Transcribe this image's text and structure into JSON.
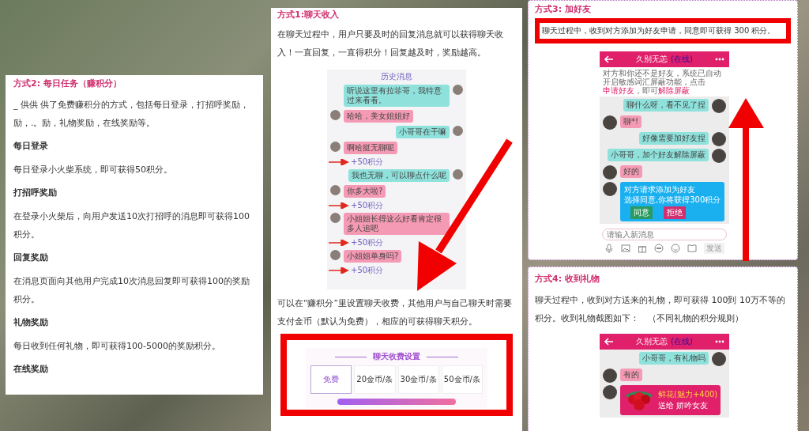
{
  "daily_tasks": {
    "title": "方式2: 每日任务（赚积分）",
    "intro": "_ 供供 供了免费赚积分的方式，包括每日登录，打招呼奖励，励，.。励，礼物奖励，在线奖励等。",
    "sections": [
      {
        "heading": "每日登录",
        "text": "每日登录小火柴系统，即可获得50积分。"
      },
      {
        "heading": "打招呼奖励",
        "text": "在登录小火柴后，向用户发送10次打招呼的消息即可获得100积分。"
      },
      {
        "heading": "回复奖励",
        "text": "在消息页面向其他用户完成10次消息回复即可获得100的奖励积分。"
      },
      {
        "heading": "礼物奖励",
        "text": "每日收到任何礼物，即可获得100-5000的奖励积分。"
      },
      {
        "heading": "在线奖励"
      }
    ]
  },
  "chat_income": {
    "title": "方式1:聊天收入",
    "intro": "在聊天过程中，用户只要及时的回复消息就可以获得聊天收入！一直回复，一直得积分！回复越及时，奖励越高。",
    "chat": {
      "history": "历史消息",
      "messages": [
        {
          "outgoing": true,
          "text": "听说这里有拉菲哥，我特意过来看看。"
        },
        {
          "outgoing": false,
          "text": "哈哈，美女姐姐好"
        },
        {
          "outgoing": true,
          "text": "小哥哥在干嘛"
        },
        {
          "outgoing": false,
          "text": "啊哈挺无聊呢",
          "reward": "+50积分"
        },
        {
          "outgoing": true,
          "text": "我也无聊，可以聊点什么呢"
        },
        {
          "outgoing": false,
          "text": "你多大啦?",
          "reward": "+50积分"
        },
        {
          "outgoing": false,
          "text": "小姐姐长得这么好看肯定很多人追吧",
          "reward": "+50积分"
        },
        {
          "outgoing": false,
          "text": "小姐姐单身吗?",
          "reward": "+50积分"
        }
      ]
    },
    "note": "可以在“赚积分”里设置聊天收费，其他用户与自己聊天时需要支付金币（默认为免费），相应的可获得聊天积分。",
    "fee_settings": {
      "title": "聊天收费设置",
      "options": [
        {
          "label": "免费",
          "selected": true
        },
        {
          "label": "20金币/条",
          "selected": false
        },
        {
          "label": "30金币/条",
          "selected": false
        },
        {
          "label": "50金币/条",
          "selected": false
        }
      ]
    }
  },
  "add_friend": {
    "title": "方式3: 加好友",
    "intro": "聊天过程中，收到对方添加为好友申请，同意即可获得 300 积分。",
    "phone": {
      "name": "久别无恙",
      "status": "(在线)",
      "notice_1": "对方和你还不是好友，系统已自动开启敏感词汇屏蔽功能，点击",
      "link_1": "申请好友",
      "notice_2": "，即可",
      "link_2": "解除屏蔽",
      "messages": [
        {
          "outgoing": true,
          "text": "聊什么呀，看不见了捏"
        },
        {
          "outgoing": false,
          "text": "聊*!"
        },
        {
          "outgoing": true,
          "text": "好像需要加好友捏"
        },
        {
          "outgoing": true,
          "text": "小哥哥，加个好友解除屏蔽"
        },
        {
          "outgoing": false,
          "text": "好的"
        }
      ],
      "request": {
        "title": "对方请求添加为好友",
        "subtitle": "选择同意,你将获得300积分",
        "accept": "同意",
        "reject": "拒绝"
      },
      "input_placeholder": "请输入新消息",
      "send": "发送"
    }
  },
  "gifts": {
    "title": "方式4: 收到礼物",
    "intro": "聊天过程中，收到对方送来的礼物，即可获得 100到 10万不等的积分。收到礼物截图如下：　（不同礼物的积分规则）",
    "phone": {
      "name": "久别无恙",
      "status": "(在线)",
      "messages": [
        {
          "outgoing": true,
          "text": "小哥哥，有礼物吗"
        },
        {
          "outgoing": false,
          "text": "有的"
        }
      ],
      "gift": {
        "name": "鲜花(魅力+400)",
        "to": "送给 娇吟女友"
      }
    }
  }
}
